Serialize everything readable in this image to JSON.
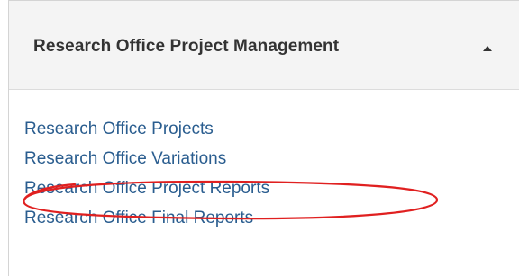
{
  "header": {
    "title": "Research Office Project Management",
    "caret_icon": "caret-up-icon"
  },
  "links": [
    {
      "label": "Research Office Projects"
    },
    {
      "label": "Research Office Variations"
    },
    {
      "label": "Research Office Project Reports"
    },
    {
      "label": "Research Office Final Reports"
    }
  ],
  "annotation": {
    "highlighted_item": "Research Office Project Reports",
    "color": "#e02020"
  },
  "colors": {
    "link": "#2a5d8f",
    "header_bg": "#f4f4f4",
    "header_text": "#333333"
  }
}
